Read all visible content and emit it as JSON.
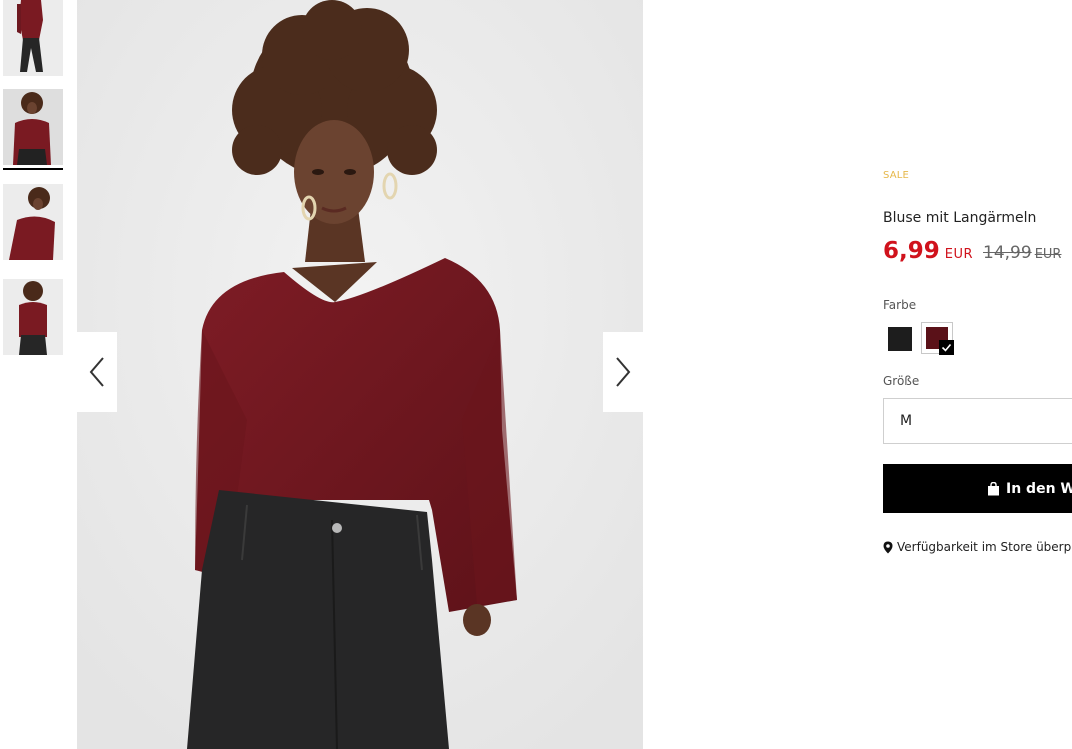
{
  "gallery": {
    "thumbnails": [
      {
        "icon": "product-photo-full-body"
      },
      {
        "icon": "product-photo-portrait"
      },
      {
        "icon": "product-photo-side"
      },
      {
        "icon": "product-photo-back"
      }
    ],
    "active_index": 1,
    "main_image_icon": "product-photo-main",
    "prev_icon": "chevron-left-icon",
    "next_icon": "chevron-right-icon"
  },
  "product": {
    "badge": "SALE",
    "title": "Bluse mit Langärmeln",
    "price_new": "6,99",
    "price_new_currency": "EUR",
    "price_old": "14,99",
    "price_old_currency": "EUR"
  },
  "color": {
    "label": "Farbe",
    "options": [
      {
        "name": "black",
        "hex": "#1d1d1d"
      },
      {
        "name": "burgundy",
        "hex": "#5a1118",
        "selected": true
      }
    ]
  },
  "size": {
    "label": "Größe",
    "selected": "M"
  },
  "cart": {
    "label": "In den Warenkorb",
    "icon": "shopping-bag-icon"
  },
  "store": {
    "label": "Verfügbarkeit im Store überprüfen",
    "icon": "location-pin-icon"
  },
  "colors": {
    "sale": "#e6b84a",
    "price": "#d0121c",
    "button": "#000000"
  }
}
